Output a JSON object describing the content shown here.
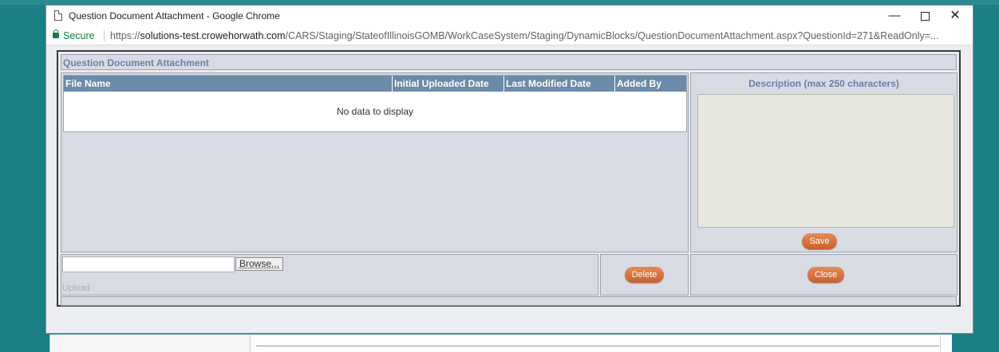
{
  "window": {
    "title": "Question Document Attachment - Google Chrome",
    "minimize_glyph": "—",
    "close_glyph": "✕"
  },
  "addressbar": {
    "secure_label": "Secure",
    "url_scheme": "https://",
    "url_host": "solutions-test.crowehorwath.com",
    "url_path": "/CARS/Staging/StateofIllinoisGOMB/WorkCaseSystem/Staging/DynamicBlocks/QuestionDocumentAttachment.aspx?QuestionId=271&ReadOnly=..."
  },
  "dialog": {
    "header_title": "Question Document Attachment",
    "grid": {
      "columns": [
        "File Name",
        "Initial Uploaded Date",
        "Last Modified Date",
        "Added By"
      ],
      "empty_text": "No data to display"
    },
    "description": {
      "label": "Description (max 250 characters)",
      "value": ""
    },
    "save_label": "Save",
    "browse_label": "Browse...",
    "upload_label": "Upload",
    "delete_label": "Delete",
    "close_label": "Close"
  },
  "colors": {
    "grid_header": "#6c8aa9",
    "button_orange": "#d5713e",
    "label_blue": "#6a7fa8",
    "secure_green": "#0b8043"
  },
  "icons": {
    "tab_icon": "document-icon",
    "secure_icon": "lock-icon"
  }
}
